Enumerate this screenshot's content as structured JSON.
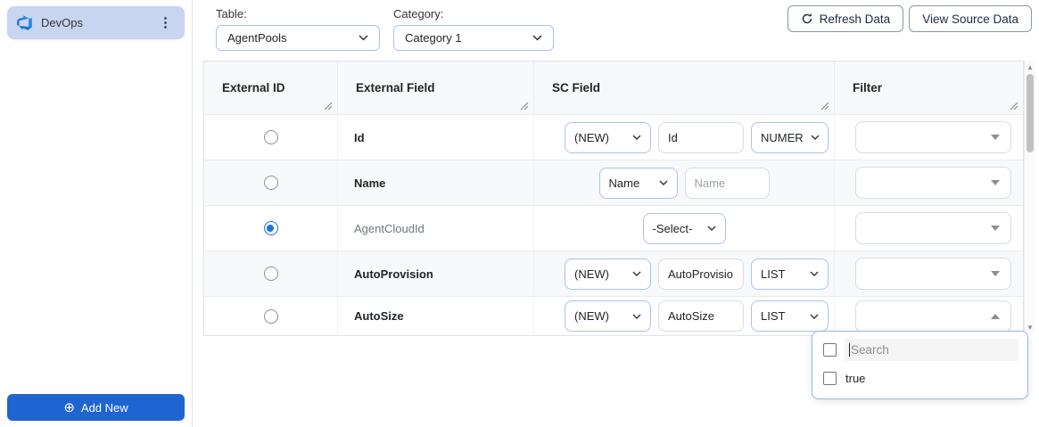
{
  "sidebar": {
    "connector_label": "DevOps",
    "add_new_label": "Add New"
  },
  "toolbar": {
    "table_label": "Table:",
    "table_value": "AgentPools",
    "category_label": "Category:",
    "category_value": "Category 1",
    "refresh_label": "Refresh Data",
    "view_source_label": "View Source Data"
  },
  "table": {
    "columns": [
      "External ID",
      "External Field",
      "SC Field",
      "Filter"
    ],
    "rows": [
      {
        "external_field": "Id",
        "sc_select": "(NEW)",
        "sc_input_value": "Id",
        "sc_type": "NUMER"
      },
      {
        "external_field": "Name",
        "sc_select": "Name",
        "sc_input_placeholder": "Name"
      },
      {
        "external_field": "AgentCloudId",
        "sc_select": "-Select-"
      },
      {
        "external_field": "AutoProvision",
        "sc_select": "(NEW)",
        "sc_input_value": "AutoProvisio",
        "sc_type": "LIST"
      },
      {
        "external_field": "AutoSize",
        "sc_select": "(NEW)",
        "sc_input_value": "AutoSize",
        "sc_type": "LIST"
      }
    ]
  },
  "filter_dropdown": {
    "search_placeholder": "Search",
    "options": [
      "true"
    ]
  },
  "colors": {
    "accent_blue": "#1f65d2",
    "card_blue": "#c9d5f0",
    "radio_checked": "#1a73e8"
  }
}
